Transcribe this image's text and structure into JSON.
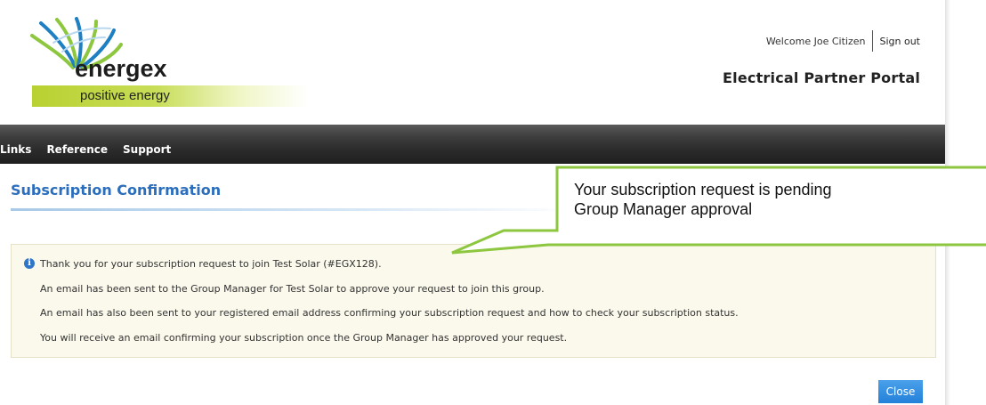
{
  "header": {
    "logo_text": "energex",
    "tagline": "positive energy",
    "welcome_text": "Welcome Joe Citizen",
    "signout_label": "Sign out",
    "portal_title": "Electrical Partner Portal"
  },
  "nav": {
    "items": [
      {
        "label": "Links"
      },
      {
        "label": "Reference"
      },
      {
        "label": "Support"
      }
    ]
  },
  "main": {
    "page_title": "Subscription Confirmation",
    "info_icon": "info-icon",
    "messages": [
      "Thank you for your subscription request to join Test Solar (#EGX128).",
      "An email has been sent to the Group Manager for Test Solar to approve your request to join this group.",
      "An email has also been sent to your registered email address confirming your subscription request and how to check your subscription status.",
      "You will receive an email confirming your subscription once the Group Manager has approved your request."
    ],
    "close_label": "Close"
  },
  "callout": {
    "line1": "Your subscription request is pending",
    "line2": "Group Manager approval"
  },
  "colors": {
    "brand_green": "#8dc63f",
    "title_blue": "#2a6ebd",
    "button_blue": "#2381d9",
    "nav_dark": "#2b2b2b",
    "info_background": "#fbf9ec"
  }
}
